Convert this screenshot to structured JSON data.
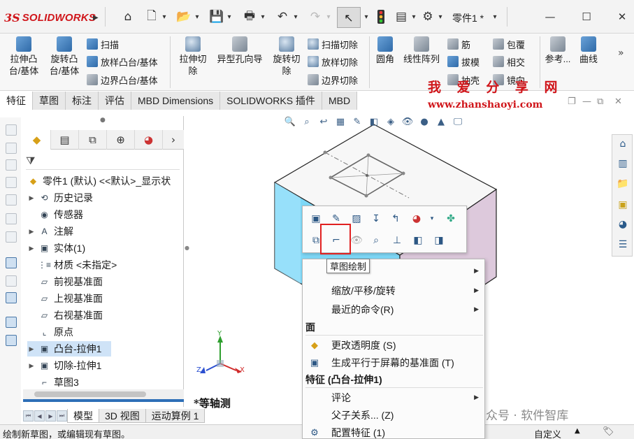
{
  "app": {
    "logo_mark": "3S",
    "logo_text": "SOLIDWORKS",
    "doc_title": "零件1 *"
  },
  "ribbon": {
    "extrude_boss": "拉伸凸\n台/基体",
    "revolve_boss": "旋转凸\n台/基体",
    "sweep": "扫描",
    "loft_boss": "放样凸台/基体",
    "boundary_boss": "边界凸台/基体",
    "extrude_cut": "拉伸切\n除",
    "hole_wizard": "异型孔向导",
    "revolve_cut": "旋转切\n除",
    "swept_cut": "扫描切除",
    "lofted_cut": "放样切除",
    "boundary_cut": "边界切除",
    "fillet": "圆角",
    "linear_pattern": "线性阵列",
    "rib": "筋",
    "draft": "拔模",
    "shell": "抽壳",
    "wrap": "包覆",
    "intersect": "相交",
    "mirror": "镜向",
    "reference": "参考...",
    "curves": "曲线"
  },
  "tabs": [
    "特征",
    "草图",
    "标注",
    "评估",
    "MBD Dimensions",
    "SOLIDWORKS 插件",
    "MBD"
  ],
  "watermark": {
    "title": "我 爱 分 享 网",
    "url": "www.zhanshaoyi.com",
    "bottom": "公众号 · 软件智库"
  },
  "tree": {
    "root": "零件1 (默认) <<默认>_显示状",
    "items": [
      {
        "label": "历史记录",
        "expandable": true
      },
      {
        "label": "传感器",
        "expandable": false
      },
      {
        "label": "注解",
        "expandable": true
      },
      {
        "label": "实体(1)",
        "expandable": true
      },
      {
        "label": "材质 <未指定>",
        "expandable": false
      },
      {
        "label": "前视基准面",
        "expandable": false
      },
      {
        "label": "上视基准面",
        "expandable": false
      },
      {
        "label": "右视基准面",
        "expandable": false
      },
      {
        "label": "原点",
        "expandable": false
      },
      {
        "label": "凸台-拉伸1",
        "expandable": true,
        "selected": true
      },
      {
        "label": "切除-拉伸1",
        "expandable": true
      },
      {
        "label": "草图3",
        "expandable": false
      }
    ]
  },
  "bottom_tabs": [
    "模型",
    "3D 视图",
    "运动算例 1"
  ],
  "status": {
    "text": "绘制新草图，或编辑现有草图。",
    "right": "自定义"
  },
  "viewport": {
    "view_label": "*等轴测",
    "axis_x": "X",
    "axis_y": "Y",
    "axis_z": "Z"
  },
  "tooltip": "草图绘制",
  "context_menu": {
    "items": [
      {
        "label": "缩放/平移/旋转",
        "submenu": true
      },
      {
        "label": "最近的命令(R)",
        "submenu": true
      }
    ],
    "section_face": "面",
    "face_items": [
      {
        "label": "更改透明度 (S)",
        "icon": "transparency-icon"
      },
      {
        "label": "生成平行于屏幕的基准面 (T)",
        "icon": "plane-icon"
      }
    ],
    "section_feature": "特征 (凸台-拉伸1)",
    "feature_items": [
      {
        "label": "评论",
        "submenu": true
      },
      {
        "label": "父子关系... (Z)",
        "submenu": false
      },
      {
        "label": "配置特征 (1)",
        "submenu": false
      }
    ]
  },
  "colors": {
    "brand_red": "#d0161b",
    "highlight_red": "#e02020",
    "selected_face": "#7ed8f7",
    "selection_blue": "#2e6fb7"
  }
}
